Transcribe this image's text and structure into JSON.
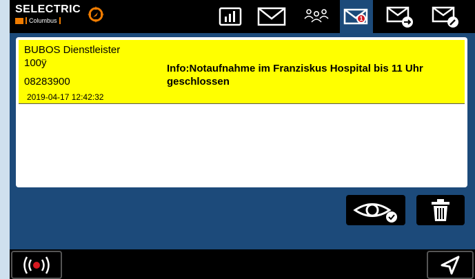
{
  "brand": {
    "name": "SELECTRIC",
    "subtitle": "Columbus",
    "accent_color": "#f07c00"
  },
  "tabs": [
    {
      "id": "status",
      "icon": "bar-chart-icon",
      "active": false
    },
    {
      "id": "messages",
      "icon": "envelope-icon",
      "active": false
    },
    {
      "id": "groups",
      "icon": "group-icon",
      "active": false
    },
    {
      "id": "inbox",
      "icon": "envelope-badge-icon",
      "active": true,
      "badge": "1"
    },
    {
      "id": "outbox",
      "icon": "envelope-send-icon",
      "active": false
    },
    {
      "id": "compose",
      "icon": "envelope-edit-icon",
      "active": false
    }
  ],
  "messages": [
    {
      "sender": "BUBOS Dienstleister",
      "code": "100ÿ",
      "number": "08283900",
      "timestamp": "2019-04-17 12:42:32",
      "text": "Info:Notaufnahme im Franziskus Hospital bis 11 Uhr geschlossen",
      "highlight_color": "#ffff00"
    }
  ],
  "actions": {
    "read_icon": "eye-check-icon",
    "delete_icon": "trash-icon"
  },
  "bottom": {
    "alarm_icon": "emergency-signal-icon",
    "send_icon": "send-arrow-icon"
  }
}
